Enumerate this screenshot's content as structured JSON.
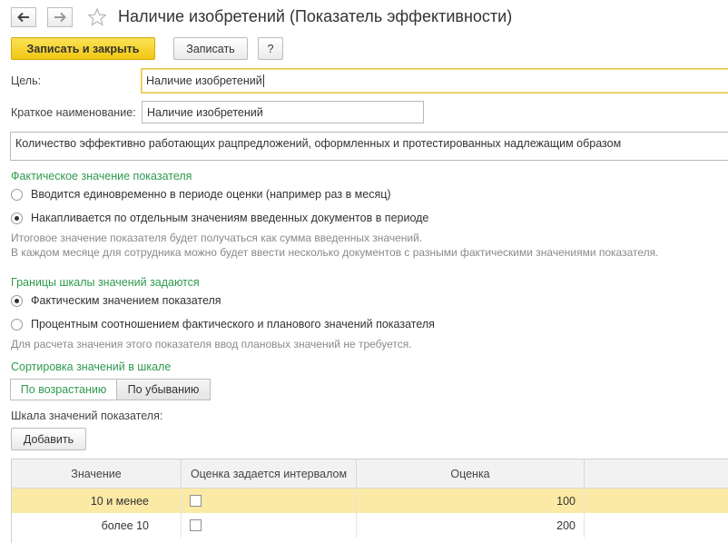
{
  "header": {
    "title": "Наличие изобретений (Показатель эффективности)",
    "back_icon": "arrow-left-icon",
    "forward_icon": "arrow-right-icon",
    "favorite_icon": "star-icon"
  },
  "toolbar": {
    "save_close_label": "Записать и закрыть",
    "save_label": "Записать",
    "help_label": "?"
  },
  "form": {
    "goal_label": "Цель:",
    "goal_value": "Наличие изобретений",
    "short_name_label": "Краткое наименование:",
    "short_name_value": "Наличие изобретений",
    "description_value": "Количество эффективно работающих рацпредложений, оформленных и протестированных надлежащим образом"
  },
  "actual_value": {
    "title": "Фактическое значение показателя",
    "option_once": "Вводится единовременно в периоде оценки (например раз в месяц)",
    "option_accumulated": "Накапливается по отдельным значениям введенных документов в периоде",
    "selected": "accumulated",
    "note_line1": "Итоговое значение показателя будет получаться как сумма введенных значений.",
    "note_line2": "В каждом месяце для сотрудника можно будет ввести несколько документов с разными фактическими значениями показателя."
  },
  "scale_bounds": {
    "title": "Границы шкалы значений задаются",
    "option_actual": "Фактическим значением показателя",
    "option_percent": "Процентным соотношением фактического и планового значений показателя",
    "selected": "actual",
    "note": "Для расчета значения этого показателя ввод плановых значений не требуется."
  },
  "sorting": {
    "title": "Сортировка значений в шкале",
    "ascending_label": "По возрастанию",
    "descending_label": "По убыванию",
    "selected": "ascending"
  },
  "scale": {
    "label": "Шкала значений показателя:",
    "add_label": "Добавить",
    "columns": [
      "Значение",
      "Оценка задается интервалом",
      "Оценка"
    ],
    "rows": [
      {
        "value": "10 и менее",
        "interval": false,
        "score": "100"
      },
      {
        "value": "более 10",
        "interval": false,
        "score": "200"
      }
    ]
  },
  "colors": {
    "accent_green": "#2f9a4e",
    "primary_button": "#f2c613",
    "selected_row": "#fbeaa5"
  }
}
